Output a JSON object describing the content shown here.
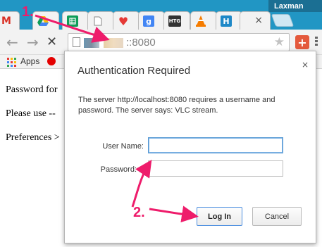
{
  "browser": {
    "profile_name": "Laxman",
    "tabs": [
      {
        "icon": "gmail-icon",
        "letter": "M",
        "color": "#d93025"
      },
      {
        "icon": "drive-icon",
        "letter": "",
        "color": "#fbbc05"
      },
      {
        "icon": "sheets-icon",
        "letter": "",
        "color": "#0f9d58"
      },
      {
        "icon": "page-icon",
        "letter": "",
        "color": "#ffffff"
      },
      {
        "icon": "heart-icon",
        "letter": "♥",
        "color": "#e53935"
      },
      {
        "icon": "google-plus-icon",
        "letter": "g",
        "color": "#4285f4"
      },
      {
        "icon": "htg-icon",
        "letter": "HTG",
        "color": "#333333"
      },
      {
        "icon": "vlc-icon",
        "letter": "",
        "color": "#f57c00"
      },
      {
        "icon": "h-icon",
        "letter": "H",
        "color": "#1e88c7"
      }
    ],
    "active_tab_close": "×",
    "address_bar": {
      "url_suffix": "::8080"
    },
    "bookmarks": {
      "apps_label": "Apps"
    }
  },
  "page": {
    "lines": [
      "Password for",
      "Please use --",
      "Preferences >"
    ]
  },
  "dialog": {
    "title": "Authentication Required",
    "close": "×",
    "message": "The server http://localhost:8080 requires a username and password. The server says: VLC stream.",
    "username_label": "User Name:",
    "username_value": "",
    "password_label": "Password:",
    "password_value": "",
    "login_label": "Log In",
    "cancel_label": "Cancel"
  },
  "annotations": {
    "step1": "1.",
    "step2": "2.",
    "color": "#ee1c6b"
  }
}
